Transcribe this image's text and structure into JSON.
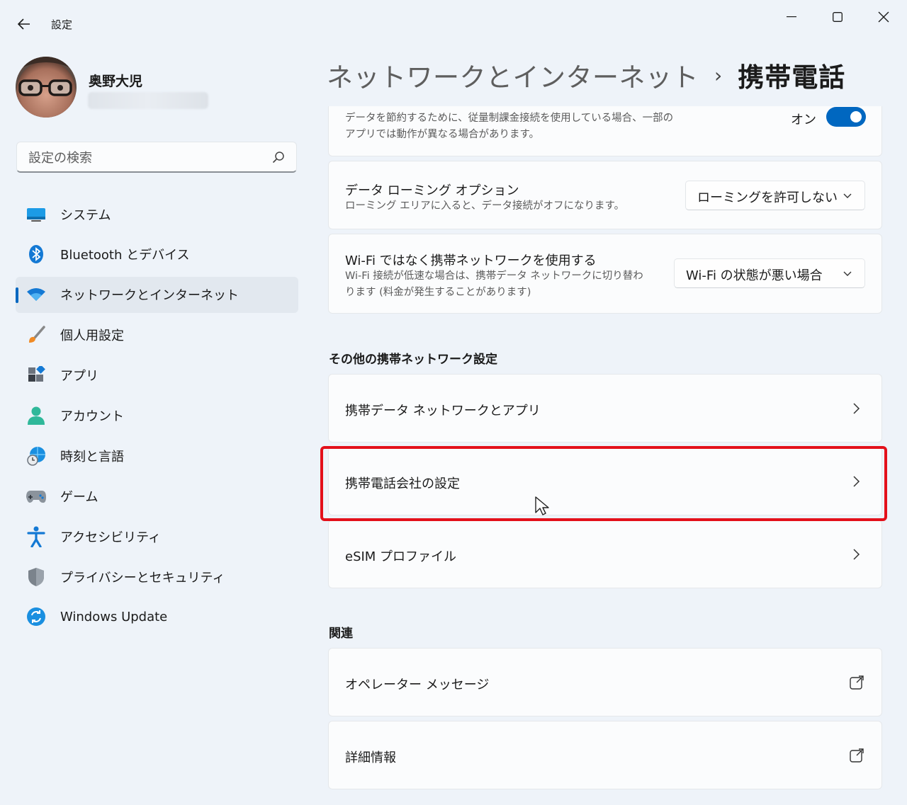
{
  "window": {
    "app_title": "設定",
    "back_icon": "arrow-left-icon",
    "controls": [
      "minimize-icon",
      "maximize-icon",
      "close-icon"
    ]
  },
  "profile": {
    "name": "奥野大児"
  },
  "search": {
    "placeholder": "設定の検索"
  },
  "nav": {
    "items": [
      {
        "label": "システム",
        "icon": "system-display-icon",
        "selected": false
      },
      {
        "label": "Bluetooth とデバイス",
        "icon": "bluetooth-icon",
        "selected": false
      },
      {
        "label": "ネットワークとインターネット",
        "icon": "wifi-icon",
        "selected": true
      },
      {
        "label": "個人用設定",
        "icon": "brush-icon",
        "selected": false
      },
      {
        "label": "アプリ",
        "icon": "apps-icon",
        "selected": false
      },
      {
        "label": "アカウント",
        "icon": "account-person-icon",
        "selected": false
      },
      {
        "label": "時刻と言語",
        "icon": "globe-clock-icon",
        "selected": false
      },
      {
        "label": "ゲーム",
        "icon": "gamepad-icon",
        "selected": false
      },
      {
        "label": "アクセシビリティ",
        "icon": "accessibility-icon",
        "selected": false
      },
      {
        "label": "プライバシーとセキュリティ",
        "icon": "shield-icon",
        "selected": false
      },
      {
        "label": "Windows Update",
        "icon": "windows-update-icon",
        "selected": false
      }
    ]
  },
  "header": {
    "parent": "ネットワークとインターネット",
    "separator": "›",
    "current": "携帯電話"
  },
  "main": {
    "metered": {
      "desc_line1": "データを節約するために、従量制課金接続を使用している場合、一部の",
      "desc_line2": "アプリでは動作が異なる場合があります。",
      "toggle_label": "オン",
      "toggle_on": true
    },
    "roaming": {
      "title": "データ ローミング オプション",
      "desc": "ローミング エリアに入ると、データ接続がオフになります。",
      "value": "ローミングを許可しない"
    },
    "wifi_fallback": {
      "title": "Wi-Fi ではなく携帯ネットワークを使用する",
      "desc_line1": "Wi-Fi 接続が低速な場合は、携帯データ ネットワークに切り替わ",
      "desc_line2": "ります (料金が発生することがあります)",
      "value": "Wi-Fi の状態が悪い場合"
    },
    "other_section_title": "その他の携帯ネットワーク設定",
    "other_items": [
      {
        "label": "携帯データ ネットワークとアプリ"
      },
      {
        "label": "携帯電話会社の設定"
      },
      {
        "label": "eSIM プロファイル"
      }
    ],
    "related_section_title": "関連",
    "related_items": [
      {
        "label": "オペレーター メッセージ"
      },
      {
        "label": "詳細情報"
      }
    ]
  },
  "colors": {
    "accent": "#0067c0",
    "highlight_border": "#e3101a",
    "background": "#eef3f9",
    "card": "#fbfcfd"
  }
}
